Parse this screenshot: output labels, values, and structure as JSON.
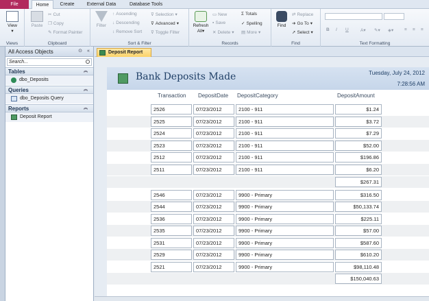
{
  "tabs": [
    "File",
    "Home",
    "Create",
    "External Data",
    "Database Tools"
  ],
  "ribbon": {
    "views": {
      "view_label": "View",
      "group": "Views"
    },
    "clipboard": {
      "paste": "Paste",
      "cut": "Cut",
      "copy": "Copy",
      "format_painter": "Format Painter",
      "group": "Clipboard"
    },
    "sort_filter": {
      "filter": "Filter",
      "ascending": "Ascending",
      "descending": "Descending",
      "remove_sort": "Remove Sort",
      "selection": "Selection",
      "advanced": "Advanced",
      "toggle_filter": "Toggle Filter",
      "group": "Sort & Filter"
    },
    "records": {
      "refresh": "Refresh",
      "refresh2": "All",
      "new": "New",
      "save": "Save",
      "delete": "Delete",
      "totals": "Totals",
      "spelling": "Spelling",
      "more": "More",
      "group": "Records"
    },
    "find": {
      "find": "Find",
      "replace": "Replace",
      "goto": "Go To",
      "select": "Select",
      "group": "Find"
    },
    "text_formatting": {
      "group": "Text Formatting",
      "bold": "B",
      "italic": "I",
      "underline": "U"
    }
  },
  "nav": {
    "title": "All Access Objects",
    "search_placeholder": "Search...",
    "sections": [
      {
        "label": "Tables",
        "items": [
          "dbo_Deposits"
        ]
      },
      {
        "label": "Queries",
        "items": [
          "dbo_Deposits Query"
        ]
      },
      {
        "label": "Reports",
        "items": [
          "Deposit Report"
        ]
      }
    ]
  },
  "doc_tab": "Deposit Report",
  "report": {
    "title": "Bank Deposits Made",
    "date": "Tuesday, July 24, 2012",
    "time": "7:28:56 AM",
    "columns": [
      "Transaction",
      "DepositDate",
      "DepositCategory",
      "DepositAmount"
    ],
    "group1": [
      [
        "2526",
        "07/23/2012",
        "2100 - 911",
        "$1.24"
      ],
      [
        "2525",
        "07/23/2012",
        "2100 - 911",
        "$3.72"
      ],
      [
        "2524",
        "07/23/2012",
        "2100 - 911",
        "$7.29"
      ],
      [
        "2523",
        "07/23/2012",
        "2100 - 911",
        "$52.00"
      ],
      [
        "2512",
        "07/23/2012",
        "2100 - 911",
        "$196.86"
      ],
      [
        "2511",
        "07/23/2012",
        "2100 - 911",
        "$6.20"
      ]
    ],
    "group1_total": "$267.31",
    "group2": [
      [
        "2546",
        "07/23/2012",
        "9900 - Primary",
        "$316.50"
      ],
      [
        "2544",
        "07/23/2012",
        "9900 - Primary",
        "$50,133.74"
      ],
      [
        "2536",
        "07/23/2012",
        "9900 - Primary",
        "$225.11"
      ],
      [
        "2535",
        "07/23/2012",
        "9900 - Primary",
        "$57.00"
      ],
      [
        "2531",
        "07/23/2012",
        "9900 - Primary",
        "$587.60"
      ],
      [
        "2529",
        "07/23/2012",
        "9900 - Primary",
        "$610.20"
      ],
      [
        "2521",
        "07/23/2012",
        "9900 - Primary",
        "$98,110.48"
      ]
    ],
    "group2_total": "$150,040.63"
  }
}
